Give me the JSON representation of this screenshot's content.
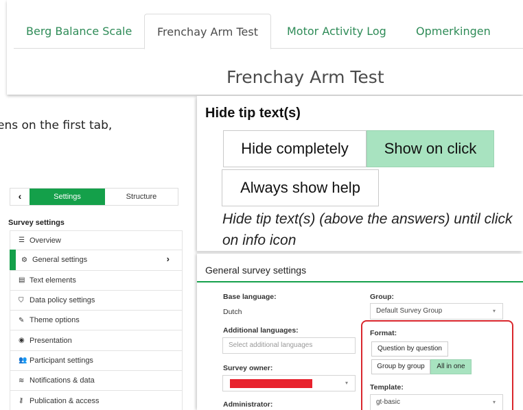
{
  "tabs": {
    "items": [
      {
        "label": "Berg Balance Scale"
      },
      {
        "label": "Frenchay Arm Test"
      },
      {
        "label": "Motor Activity Log"
      },
      {
        "label": "Opmerkingen"
      }
    ],
    "active_index": 1,
    "heading": "Frenchay Arm Test"
  },
  "partial_text": "ens on the first tab,",
  "sidebar": {
    "back_label": "‹",
    "settings_label": "Settings",
    "structure_label": "Structure",
    "section_heading": "Survey settings",
    "items": [
      {
        "icon": "☰",
        "label": "Overview"
      },
      {
        "icon": "⚙",
        "label": "General settings",
        "active": true,
        "arrow": "›"
      },
      {
        "icon": "▤",
        "label": "Text elements"
      },
      {
        "icon": "⛉",
        "label": "Data policy settings"
      },
      {
        "icon": "✎",
        "label": "Theme options"
      },
      {
        "icon": "◉",
        "label": "Presentation"
      },
      {
        "icon": "👥",
        "label": "Participant settings"
      },
      {
        "icon": "≋",
        "label": "Notifications & data"
      },
      {
        "icon": "⚷",
        "label": "Publication & access"
      }
    ]
  },
  "tip": {
    "title": "Hide tip text(s)",
    "buttons": {
      "hide_completely": "Hide completely",
      "show_on_click": "Show on click",
      "always_show": "Always show help"
    },
    "selected": "show_on_click",
    "description": "Hide tip text(s) (above the answers) until click on info icon"
  },
  "general": {
    "title": "General survey settings",
    "base_language_label": "Base language:",
    "base_language_value": "Dutch",
    "additional_languages_label": "Additional languages:",
    "additional_languages_placeholder": "Select additional languages",
    "survey_owner_label": "Survey owner:",
    "administrator_label": "Administrator:",
    "group_label": "Group:",
    "group_value": "Default Survey Group",
    "format_label": "Format:",
    "format_options": {
      "question_by_question": "Question by question",
      "group_by_group": "Group by group",
      "all_in_one": "All in one"
    },
    "format_selected": "all_in_one",
    "template_label": "Template:",
    "template_value": "gt-basic",
    "dropdown_caret": "▾",
    "colors": {
      "accent": "#14a04a",
      "selected_fill": "#a8e3c0",
      "highlight_outline": "#d9262c",
      "redacted": "#e8222d"
    }
  }
}
